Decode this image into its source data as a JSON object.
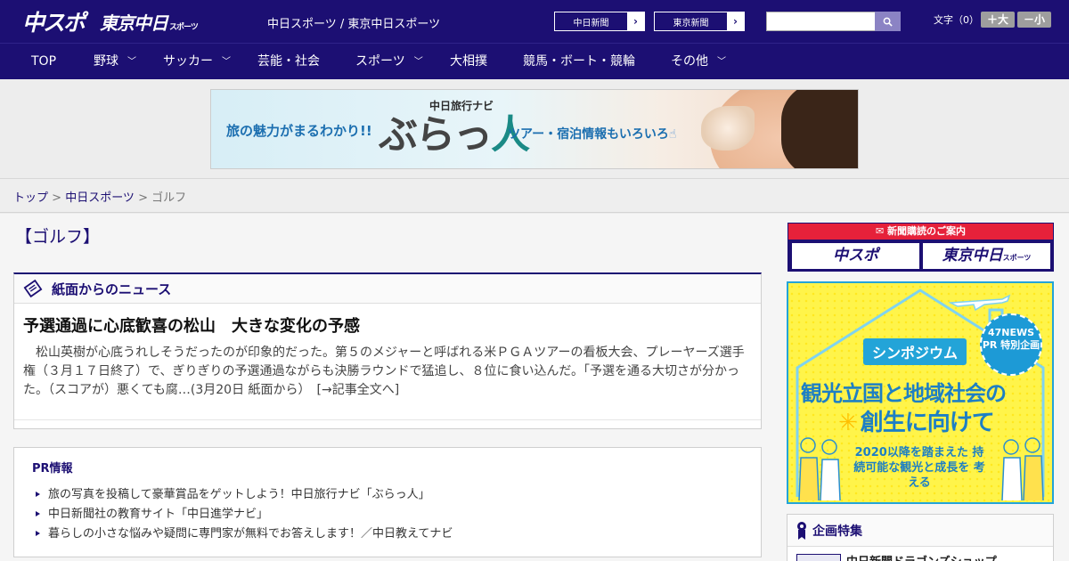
{
  "header": {
    "logo_chuspo": "中スポ",
    "logo_tokyo": "東京中日",
    "logo_tokyo_sub": "スポーツ",
    "title": "中日スポーツ / 東京中日スポーツ",
    "btn_chunichi": "中日新聞",
    "btn_tokyo": "東京新聞",
    "search_placeholder": "",
    "font_size_label": "文字（0）",
    "font_large": "＋大",
    "font_small": "－小"
  },
  "nav": {
    "items": [
      {
        "label": "TOP"
      },
      {
        "label": "野球",
        "dropdown": true
      },
      {
        "label": "サッカー",
        "dropdown": true
      },
      {
        "label": "芸能・社会"
      },
      {
        "label": "スポーツ",
        "dropdown": true
      },
      {
        "label": "大相撲"
      },
      {
        "label": "競馬・ボート・競輪"
      },
      {
        "label": "その他",
        "dropdown": true
      }
    ]
  },
  "banner": {
    "left_text": "旅の魅力がまるわかり!!",
    "brand_small": "中日旅行ナビ",
    "brand_big_a": "ぶらっ",
    "brand_big_b": "人",
    "right_text": "ツアー・宿泊情報もいろいろ"
  },
  "breadcrumb": {
    "top": "トップ",
    "sep1": " > ",
    "section": "中日スポーツ",
    "sep2": " > ",
    "current": "ゴルフ"
  },
  "page_title": "【ゴルフ】",
  "news": {
    "heading": "紙面からのニュース",
    "article_title": "予選通過に心底歓喜の松山　大きな変化の予感",
    "article_body": "松山英樹が心底うれしそうだったのが印象的だった。第５のメジャーと呼ばれる米ＰＧＡツアーの看板大会、プレーヤーズ選手権（３月１７日終了）で、ぎりぎりの予選通過ながらも決勝ラウンドで猛追し、８位に食い込んだ。「予選を通る大切さが分かった。（スコアが）悪くても腐…(3月20日 紙面から）",
    "read_more": "[→記事全文へ]"
  },
  "pr": {
    "title": "PR情報",
    "items": [
      "旅の写真を投稿して豪華賞品をゲットしよう！中日旅行ナビ「ぶらっ人」",
      "中日新聞社の教育サイト「中日進学ナビ」",
      "暮らしの小さな悩みや疑問に専門家が無料でお答えします！／中日教えてナビ"
    ]
  },
  "sidebar": {
    "subscribe_head": "新聞購読のご案内",
    "subscribe_chuspo": "中スポ",
    "subscribe_tokyo": "東京中日",
    "subscribe_tokyo_sub": "スポーツ",
    "ad_badge": "47NEWS PR 特別企画",
    "ad_sympo": "シンポジウム",
    "ad_line1": "観光立国と地域社会の",
    "ad_line2": "創生に向けて",
    "ad_line3": "2020以降を踏まえた 持続可能な観光と成長を 考える",
    "kikaku_title": "企画特集",
    "kikaku_item": "中日新聞ドラゴンズショップ"
  },
  "colors": {
    "brand": "#1c0f73",
    "accent_red": "#e6213a",
    "ad_yellow": "#fff44a",
    "ad_blue": "#1d7fc4"
  }
}
